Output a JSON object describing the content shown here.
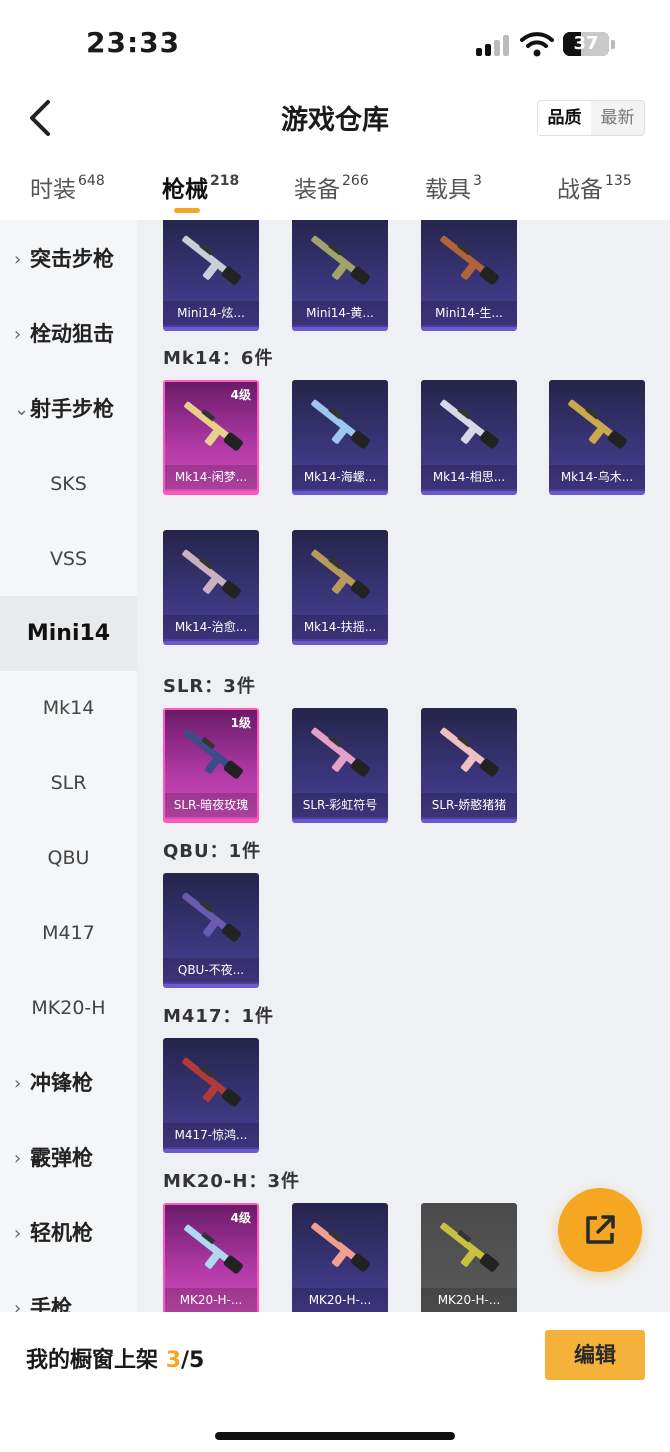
{
  "status_bar": {
    "time": "23:33",
    "battery": "37"
  },
  "header": {
    "title": "游戏仓库",
    "sort_options": [
      "品质",
      "最新"
    ],
    "sort_active": "品质"
  },
  "tabs": [
    {
      "label": "时装",
      "count": "648"
    },
    {
      "label": "枪械",
      "count": "218"
    },
    {
      "label": "装备",
      "count": "266"
    },
    {
      "label": "载具",
      "count": "3"
    },
    {
      "label": "战备",
      "count": "135"
    }
  ],
  "sidebar": {
    "items": [
      {
        "label": "突击步枪",
        "chevron": "›"
      },
      {
        "label": "栓动狙击",
        "chevron": "›"
      },
      {
        "label": "射手步枪",
        "chevron": "⌄"
      },
      {
        "label": "SKS"
      },
      {
        "label": "VSS"
      },
      {
        "label": "Mini14"
      },
      {
        "label": "Mk14"
      },
      {
        "label": "SLR"
      },
      {
        "label": "QBU"
      },
      {
        "label": "M417"
      },
      {
        "label": "MK20-H"
      },
      {
        "label": "冲锋枪",
        "chevron": "›"
      },
      {
        "label": "霰弹枪",
        "chevron": "›"
      },
      {
        "label": "轻机枪",
        "chevron": "›"
      },
      {
        "label": "手枪",
        "chevron": "›"
      }
    ]
  },
  "groups": [
    {
      "label": "",
      "items": [
        {
          "name": "Mini14-炫...",
          "level": ""
        },
        {
          "name": "Mini14-黄...",
          "level": ""
        },
        {
          "name": "Mini14-生...",
          "level": ""
        }
      ]
    },
    {
      "label": "Mk14：6件",
      "items": [
        {
          "name": "Mk14-闲梦...",
          "level": "4级"
        },
        {
          "name": "Mk14-海螺...",
          "level": ""
        },
        {
          "name": "Mk14-相思...",
          "level": ""
        },
        {
          "name": "Mk14-乌木...",
          "level": ""
        },
        {
          "name": "Mk14-治愈...",
          "level": ""
        },
        {
          "name": "Mk14-扶摇...",
          "level": ""
        }
      ]
    },
    {
      "label": "SLR：3件",
      "items": [
        {
          "name": "SLR-暗夜玫瑰",
          "level": "1级"
        },
        {
          "name": "SLR-彩虹符号",
          "level": ""
        },
        {
          "name": "SLR-娇憨猪猪",
          "level": ""
        }
      ]
    },
    {
      "label": "QBU：1件",
      "items": [
        {
          "name": "QBU-不夜...",
          "level": ""
        }
      ]
    },
    {
      "label": "M417：1件",
      "items": [
        {
          "name": "M417-惊鸿...",
          "level": ""
        }
      ]
    },
    {
      "label": "MK20-H：3件",
      "items": [
        {
          "name": "MK20-H-...",
          "level": "4级"
        },
        {
          "name": "MK20-H-...",
          "level": ""
        },
        {
          "name": "MK20-H-...",
          "level": ""
        }
      ]
    }
  ],
  "bottom_bar": {
    "label": "我的橱窗上架",
    "count": "3",
    "total": "/5",
    "edit_label": "编辑"
  },
  "colors": {
    "accent": "#f5a623",
    "card_purple": "#3a357a",
    "card_gold": "#c23fb0"
  }
}
